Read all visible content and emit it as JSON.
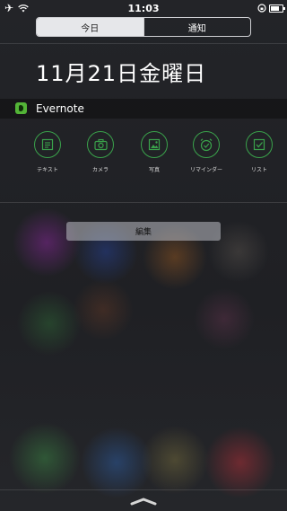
{
  "status_bar": {
    "time": "11:03",
    "left_icons": [
      "airplane-icon",
      "wifi-icon"
    ],
    "right_icons": [
      "rotation-lock-icon",
      "battery-icon"
    ]
  },
  "segmented_control": {
    "segments": [
      {
        "label": "今日",
        "selected": true
      },
      {
        "label": "通知",
        "selected": false
      }
    ]
  },
  "date_title": "11月21日金曜日",
  "widget": {
    "app_name": "Evernote",
    "app_icon": "evernote-icon",
    "accent_color": "#3aa24b",
    "shortcuts": [
      {
        "label": "テキスト",
        "icon": "text-note-icon"
      },
      {
        "label": "カメラ",
        "icon": "camera-icon"
      },
      {
        "label": "写真",
        "icon": "photo-icon"
      },
      {
        "label": "リマインダー",
        "icon": "reminder-clock-icon"
      },
      {
        "label": "リスト",
        "icon": "checklist-icon"
      }
    ]
  },
  "edit_button": {
    "label": "編集"
  },
  "pull_handle_icon": "chevron-up-handle-icon"
}
